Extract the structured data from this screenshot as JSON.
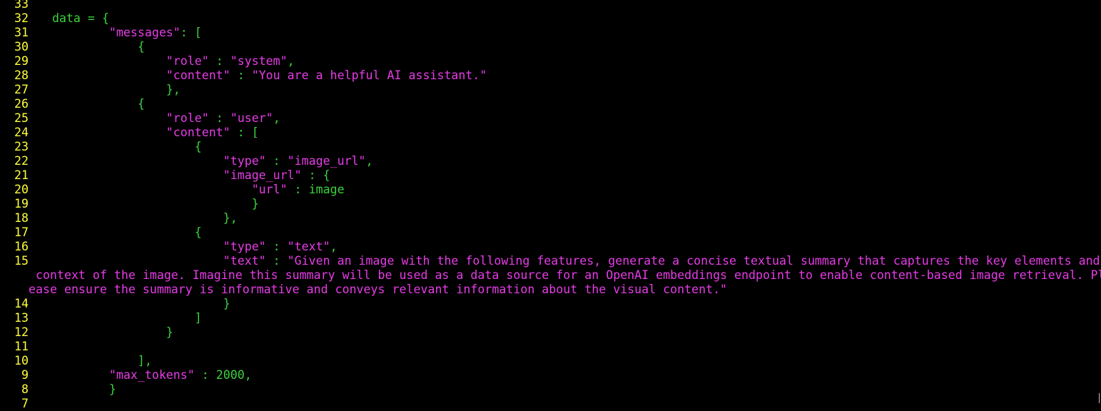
{
  "colors": {
    "background": "#000000",
    "line_number": "#ffff3c",
    "code_green": "#3cd23c",
    "string_magenta": "#e63ce6"
  },
  "editor": {
    "lines": [
      {
        "num": "33",
        "segs": []
      },
      {
        "num": "32",
        "segs": [
          {
            "c": "g",
            "t": "    data = {"
          }
        ]
      },
      {
        "num": "31",
        "segs": [
          {
            "c": "m",
            "t": "            \"messages\""
          },
          {
            "c": "g",
            "t": ": ["
          }
        ]
      },
      {
        "num": "30",
        "segs": [
          {
            "c": "g",
            "t": "                {"
          }
        ]
      },
      {
        "num": "29",
        "segs": [
          {
            "c": "m",
            "t": "                    \"role\""
          },
          {
            "c": "g",
            "t": " : "
          },
          {
            "c": "m",
            "t": "\"system\""
          },
          {
            "c": "g",
            "t": ","
          }
        ]
      },
      {
        "num": "28",
        "segs": [
          {
            "c": "m",
            "t": "                    \"content\""
          },
          {
            "c": "g",
            "t": " : "
          },
          {
            "c": "m",
            "t": "\"You are a helpful AI assistant.\""
          }
        ]
      },
      {
        "num": "27",
        "segs": [
          {
            "c": "g",
            "t": "                    },"
          }
        ]
      },
      {
        "num": "26",
        "segs": [
          {
            "c": "g",
            "t": "                {"
          }
        ]
      },
      {
        "num": "25",
        "segs": [
          {
            "c": "m",
            "t": "                    \"role\""
          },
          {
            "c": "g",
            "t": " : "
          },
          {
            "c": "m",
            "t": "\"user\""
          },
          {
            "c": "g",
            "t": ","
          }
        ]
      },
      {
        "num": "24",
        "segs": [
          {
            "c": "m",
            "t": "                    \"content\""
          },
          {
            "c": "g",
            "t": " : ["
          }
        ]
      },
      {
        "num": "23",
        "segs": [
          {
            "c": "g",
            "t": "                        {"
          }
        ]
      },
      {
        "num": "22",
        "segs": [
          {
            "c": "m",
            "t": "                            \"type\""
          },
          {
            "c": "g",
            "t": " : "
          },
          {
            "c": "m",
            "t": "\"image_url\""
          },
          {
            "c": "g",
            "t": ","
          }
        ]
      },
      {
        "num": "21",
        "segs": [
          {
            "c": "m",
            "t": "                            \"image_url\""
          },
          {
            "c": "g",
            "t": " : {"
          }
        ]
      },
      {
        "num": "20",
        "segs": [
          {
            "c": "m",
            "t": "                                \"url\""
          },
          {
            "c": "g",
            "t": " : image"
          }
        ]
      },
      {
        "num": "19",
        "segs": [
          {
            "c": "g",
            "t": "                                }"
          }
        ]
      },
      {
        "num": "18",
        "segs": [
          {
            "c": "g",
            "t": "                            },"
          }
        ]
      },
      {
        "num": "17",
        "segs": [
          {
            "c": "g",
            "t": "                        {"
          }
        ]
      },
      {
        "num": "16",
        "segs": [
          {
            "c": "m",
            "t": "                            \"type\""
          },
          {
            "c": "g",
            "t": " : "
          },
          {
            "c": "m",
            "t": "\"text\""
          },
          {
            "c": "g",
            "t": ","
          }
        ]
      },
      {
        "num": "15",
        "segs": [
          {
            "c": "m",
            "t": "                            \"text\""
          },
          {
            "c": "g",
            "t": " : "
          },
          {
            "c": "m",
            "t": "\"Given an image with the following features, generate a concise textual summary that captures the key elements and"
          }
        ]
      },
      {
        "num": "",
        "segs": [
          {
            "c": "m",
            "t": " context of the image. Imagine this summary will be used as a data source for an OpenAI embeddings endpoint to enable content-based image retrieval. Pl"
          }
        ]
      },
      {
        "num": "",
        "segs": [
          {
            "c": "m",
            "t": "ease ensure the summary is informative and conveys relevant information about the visual content.\""
          }
        ]
      },
      {
        "num": "14",
        "segs": [
          {
            "c": "g",
            "t": "                            }"
          }
        ]
      },
      {
        "num": "13",
        "segs": [
          {
            "c": "g",
            "t": "                        ]"
          }
        ]
      },
      {
        "num": "12",
        "segs": [
          {
            "c": "g",
            "t": "                    }"
          }
        ]
      },
      {
        "num": "11",
        "segs": []
      },
      {
        "num": "10",
        "segs": [
          {
            "c": "g",
            "t": "                ],"
          }
        ]
      },
      {
        "num": "9",
        "segs": [
          {
            "c": "m",
            "t": "            \"max_tokens\""
          },
          {
            "c": "g",
            "t": " : 2000,"
          }
        ]
      },
      {
        "num": "8",
        "segs": [
          {
            "c": "g",
            "t": "            }"
          }
        ]
      },
      {
        "num": "7",
        "segs": []
      }
    ]
  }
}
